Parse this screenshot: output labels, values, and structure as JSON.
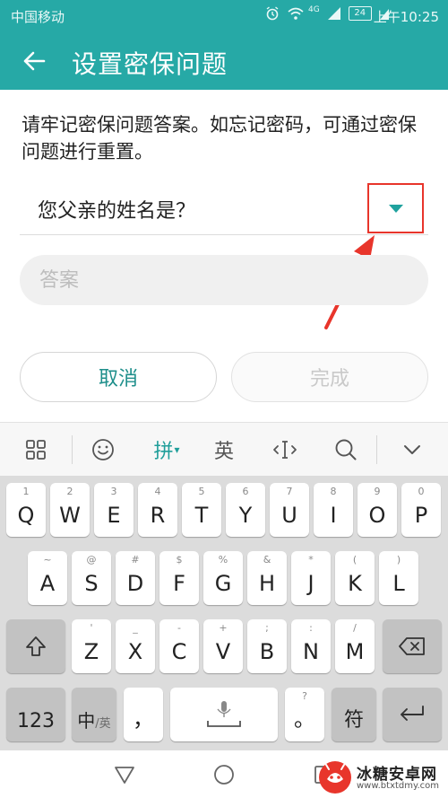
{
  "status_bar": {
    "carrier": "中国移动",
    "network": "4G",
    "battery": "24",
    "time": "上午10:25"
  },
  "header": {
    "title": "设置密保问题",
    "back_icon": "arrow-left-icon"
  },
  "form": {
    "description": "请牢记密保问题答案。如忘记密码，可通过密保问题进行重置。",
    "question": "您父亲的姓名是？",
    "dropdown_icon": "triangle-down-icon",
    "answer_placeholder": "答案",
    "cancel_label": "取消",
    "done_label": "完成"
  },
  "keyboard": {
    "toolbar": {
      "grid": "grid-icon",
      "emoji": "emoji-icon",
      "pinyin_label": "拼",
      "english_label": "英",
      "cursor": "cursor-move-icon",
      "search": "search-icon",
      "collapse": "chevron-down-icon"
    },
    "row1": [
      {
        "hint": "1",
        "label": "Q"
      },
      {
        "hint": "2",
        "label": "W"
      },
      {
        "hint": "3",
        "label": "E"
      },
      {
        "hint": "4",
        "label": "R"
      },
      {
        "hint": "5",
        "label": "T"
      },
      {
        "hint": "6",
        "label": "Y"
      },
      {
        "hint": "7",
        "label": "U"
      },
      {
        "hint": "8",
        "label": "I"
      },
      {
        "hint": "9",
        "label": "O"
      },
      {
        "hint": "0",
        "label": "P"
      }
    ],
    "row2": [
      {
        "hint": "~",
        "label": "A"
      },
      {
        "hint": "@",
        "label": "S"
      },
      {
        "hint": "#",
        "label": "D"
      },
      {
        "hint": "$",
        "label": "F"
      },
      {
        "hint": "%",
        "label": "G"
      },
      {
        "hint": "&",
        "label": "H"
      },
      {
        "hint": "*",
        "label": "J"
      },
      {
        "hint": "(",
        "label": "K"
      },
      {
        "hint": ")",
        "label": "L"
      }
    ],
    "row3": [
      {
        "hint": "'",
        "label": "Z"
      },
      {
        "hint": "_",
        "label": "X"
      },
      {
        "hint": "-",
        "label": "C"
      },
      {
        "hint": "+",
        "label": "V"
      },
      {
        "hint": ";",
        "label": "B"
      },
      {
        "hint": ":",
        "label": "N"
      },
      {
        "hint": "/",
        "label": "M"
      }
    ],
    "row4": {
      "numbers": "123",
      "lang_zh": "中",
      "lang_en": "/英",
      "comma": "，",
      "question_hint": "?",
      "period": "。",
      "symbols": "符"
    }
  },
  "watermark": {
    "name": "冰糖安卓网",
    "url": "www.btxtdmy.com"
  }
}
